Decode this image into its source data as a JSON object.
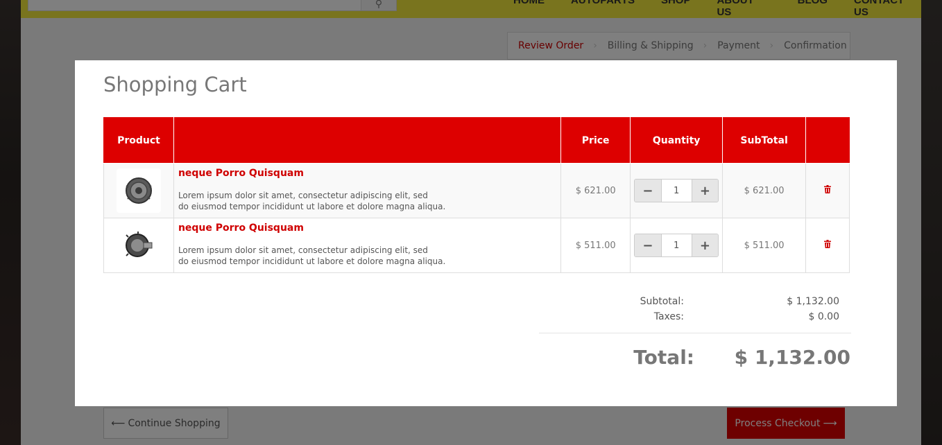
{
  "background": {
    "nav": [
      "HOME",
      "AUTOPARTS",
      "SHOP",
      "ABOUT US",
      "BLOG",
      "CONTACT US"
    ],
    "steps": [
      "Review Order",
      "Billing & Shipping",
      "Payment",
      "Confirmation"
    ],
    "continue_label": "Continue Shopping",
    "checkout_label": "Process Checkout"
  },
  "modal": {
    "title": "Shopping Cart",
    "headers": {
      "product": "Product",
      "description": "",
      "price": "Price",
      "quantity": "Quantity",
      "subtotal": "SubTotal",
      "remove": ""
    },
    "items": [
      {
        "name": "neque Porro Quisquam",
        "line1": "Lorem ipsum dolor sit amet, consectetur adipiscing elit, sed",
        "line2": "do eiusmod tempor incididunt ut labore et dolore magna aliqua.",
        "price": "$ 621.00",
        "qty": "1",
        "subtotal": "$ 621.00"
      },
      {
        "name": "neque Porro Quisquam",
        "line1": "Lorem ipsum dolor sit amet, consectetur adipiscing elit, sed",
        "line2": "do eiusmod tempor incididunt ut labore et dolore magna aliqua.",
        "price": "$ 511.00",
        "qty": "1",
        "subtotal": "$ 511.00"
      }
    ],
    "totals": {
      "subtotal_label": "Subtotal:",
      "subtotal_value": "$ 1,132.00",
      "taxes_label": "Taxes:",
      "taxes_value": "$ 0.00",
      "total_label": "Total:",
      "total_value": "$ 1,132.00"
    }
  },
  "colors": {
    "accent": "#dd0000",
    "header_yellow": "#f2e83c"
  }
}
